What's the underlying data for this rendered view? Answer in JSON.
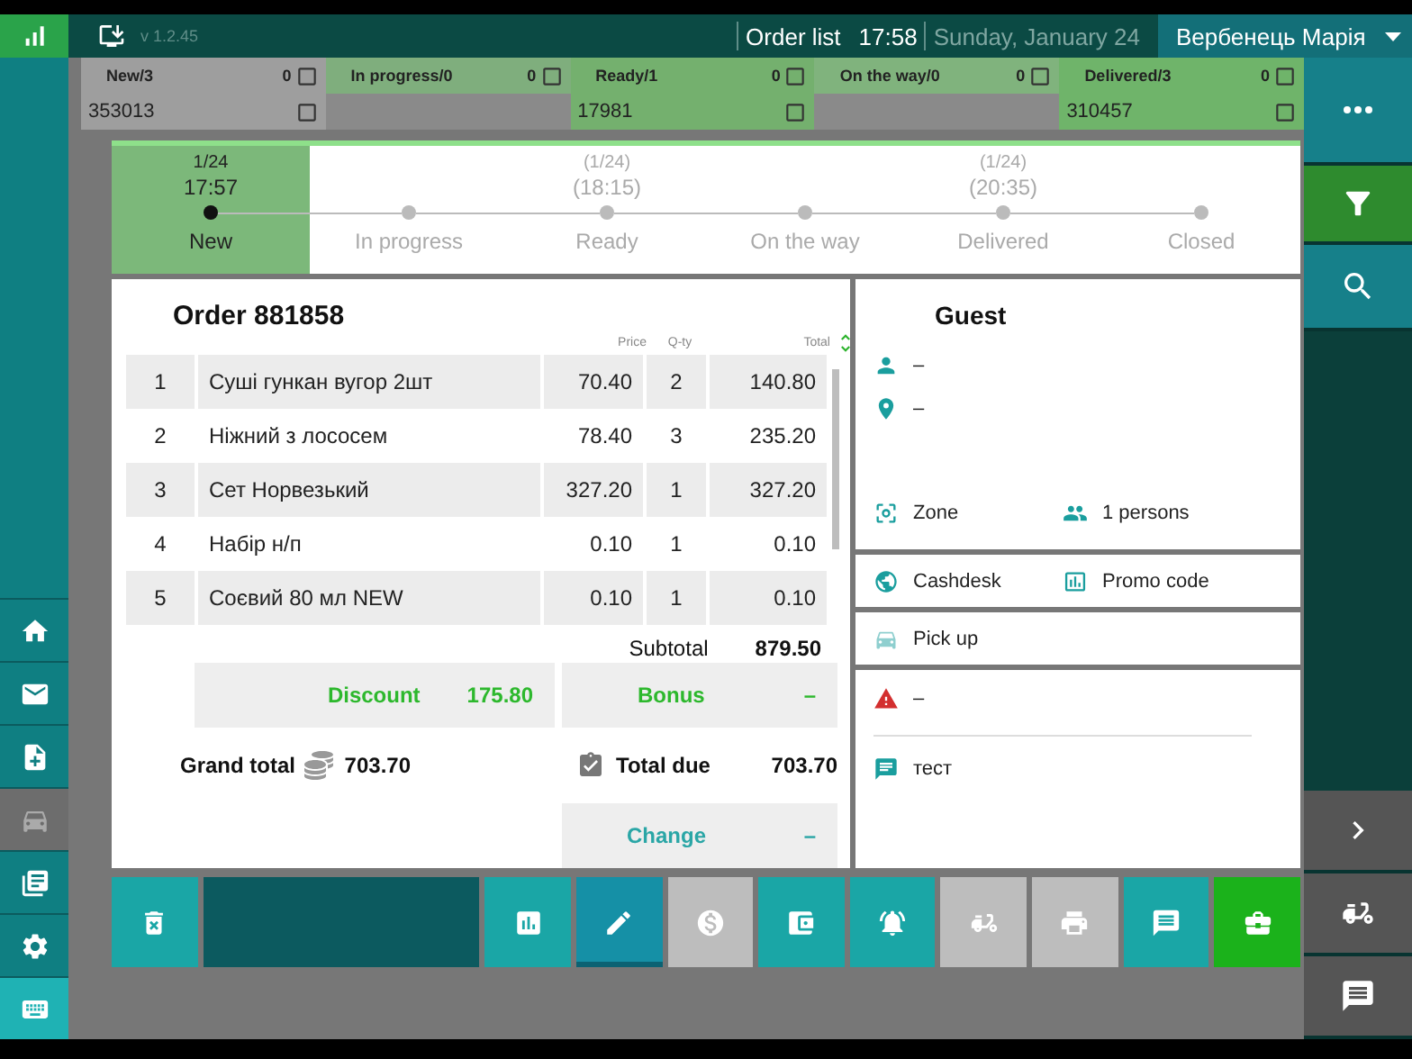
{
  "header": {
    "version": "v 1.2.45",
    "title": "Order list",
    "time": "17:58",
    "date": "Sunday, January 24",
    "user": "Вербенець Марія"
  },
  "columns": [
    {
      "label": "New/3",
      "count": "0",
      "color": "#9e9e9e",
      "order": "353013"
    },
    {
      "label": "In progress/0",
      "count": "0",
      "color": "#7fae7d"
    },
    {
      "label": "Ready/1",
      "count": "0",
      "color": "#74b06e",
      "order": "17981"
    },
    {
      "label": "On the way/0",
      "count": "0",
      "color": "#80b37d"
    },
    {
      "label": "Delivered/3",
      "count": "0",
      "color": "#6fb46a",
      "order": "310457"
    }
  ],
  "left_nav": [
    {
      "kind": "home",
      "selected": false
    },
    {
      "kind": "mail",
      "selected": false
    },
    {
      "kind": "new-doc",
      "selected": false
    },
    {
      "kind": "car",
      "selected": true
    },
    {
      "kind": "docs",
      "selected": false
    },
    {
      "kind": "settings",
      "selected": false
    },
    {
      "kind": "keyboard",
      "selected": false
    }
  ],
  "right_nav": [
    {
      "kind": "more"
    },
    {
      "kind": "filter"
    },
    {
      "kind": "search"
    },
    {
      "kind": "next"
    },
    {
      "kind": "scooter"
    },
    {
      "kind": "chat"
    }
  ],
  "stepper": [
    {
      "label": "New",
      "date": "1/24",
      "time": "17:57",
      "selected": true
    },
    {
      "label": "In progress",
      "selected": false
    },
    {
      "label": "Ready",
      "date": "(1/24)",
      "time": "(18:15)",
      "selected": false
    },
    {
      "label": "On the way",
      "selected": false
    },
    {
      "label": "Delivered",
      "date": "(1/24)",
      "time": "(20:35)",
      "selected": false
    },
    {
      "label": "Closed",
      "selected": false
    }
  ],
  "order": {
    "title": "Order 881858",
    "columns": [
      "Price",
      "Q-ty",
      "Total"
    ],
    "items": [
      {
        "no": "1",
        "name": "Суші гункан вугор 2шт",
        "price": "70.40",
        "qty": "2",
        "total": "140.80"
      },
      {
        "no": "2",
        "name": "Ніжний з лососем",
        "price": "78.40",
        "qty": "3",
        "total": "235.20"
      },
      {
        "no": "3",
        "name": "Сет Норвезький",
        "price": "327.20",
        "qty": "1",
        "total": "327.20"
      },
      {
        "no": "4",
        "name": "Набір н/п",
        "price": "0.10",
        "qty": "1",
        "total": "0.10"
      },
      {
        "no": "5",
        "name": "Соєвий 80 мл NEW",
        "price": "0.10",
        "qty": "1",
        "total": "0.10"
      }
    ],
    "subtotal_label": "Subtotal",
    "subtotal": "879.50",
    "discount_label": "Discount",
    "discount": "175.80",
    "bonus_label": "Bonus",
    "bonus": "–",
    "grand_total_label": "Grand total",
    "grand_total": "703.70",
    "total_due_label": "Total due",
    "total_due": "703.70",
    "change_label": "Change",
    "change": "–"
  },
  "guest": {
    "title": "Guest",
    "name": "–",
    "address": "–",
    "zone": "Zone",
    "persons": "1 persons",
    "cashdesk": "Cashdesk",
    "promo": "Promo code",
    "pickup": "Pick up",
    "alert": "–",
    "comment": "тест"
  },
  "toolbar": [
    {
      "kind": "delete",
      "disabled": false,
      "selected": false
    },
    {
      "kind": "blank",
      "disabled": false,
      "selected": false
    },
    {
      "kind": "report",
      "disabled": false,
      "selected": false
    },
    {
      "kind": "edit",
      "disabled": false,
      "selected": true
    },
    {
      "kind": "coin",
      "disabled": true,
      "selected": false
    },
    {
      "kind": "wallet",
      "disabled": false,
      "selected": false
    },
    {
      "kind": "bell",
      "disabled": false,
      "selected": false
    },
    {
      "kind": "scooter",
      "disabled": true,
      "selected": false
    },
    {
      "kind": "print",
      "disabled": true,
      "selected": false
    },
    {
      "kind": "chat",
      "disabled": false,
      "selected": false
    },
    {
      "kind": "confirm",
      "disabled": false,
      "selected": false
    }
  ]
}
